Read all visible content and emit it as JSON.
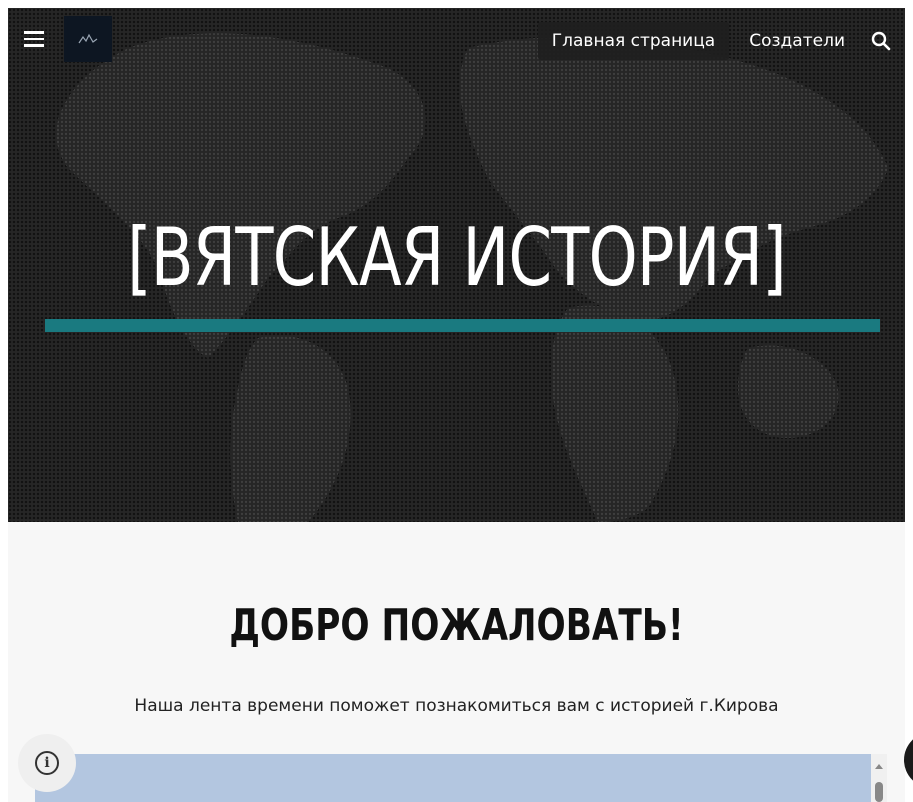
{
  "header": {
    "menu_icon": "hamburger-menu-icon",
    "logo_icon": "site-logo",
    "nav": {
      "items": [
        {
          "label": "Главная страница",
          "active": true
        },
        {
          "label": "Создатели",
          "active": false
        }
      ]
    },
    "search_icon": "search-icon"
  },
  "hero": {
    "title": "[ВЯТСКАЯ ИСТОРИЯ]",
    "accent_color": "#1a7a80",
    "background_color": "#262626"
  },
  "main": {
    "heading": "ДОБРО ПОЖАЛОВАТЬ!",
    "subtitle": "Наша лента времени поможет познакомиться вам с историей г.Кирова",
    "embed_color": "#b3c6e0"
  },
  "floating": {
    "info_icon": "info-icon",
    "info_glyph": "i"
  }
}
